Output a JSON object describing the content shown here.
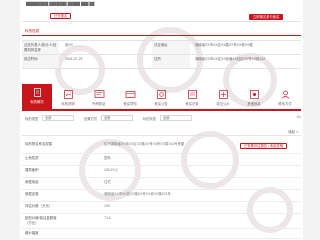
{
  "top": {
    "line1": "█████████ ███████ █████ ███ ██",
    "button_outline": "已在报名",
    "button_fill": "立即报名参与竞买"
  },
  "section_title": "标的信息",
  "info": [
    {
      "label": "法定代表人/执行人/处置机构名称",
      "value": "张XX",
      "label2": "法定地址",
      "value2": "湖南省XX市XX区XX路XX号XX栋XX楼"
    },
    {
      "label": "成交时间",
      "value": "2021-07-23",
      "label2": "住所",
      "value2": "湖南省XX市XX区XX街道XX社区XX号XX组102"
    }
  ],
  "tabs": [
    {
      "label": "标的概况",
      "icon": "document-icon"
    },
    {
      "label": "标的说明",
      "icon": "chart-icon"
    },
    {
      "label": "所有权证",
      "icon": "certificate-icon"
    },
    {
      "label": "竞买须知",
      "icon": "notice-icon"
    },
    {
      "label": "竞买公告",
      "icon": "announcement-icon"
    },
    {
      "label": "竞买记录",
      "icon": "record-icon"
    },
    {
      "label": "成交公示",
      "icon": "publicity-icon"
    },
    {
      "label": "其他信息",
      "icon": "info-icon"
    },
    {
      "label": "联系方式",
      "icon": "contact-icon"
    }
  ],
  "filters": {
    "label1": "标的类型",
    "value1": "全部",
    "label2": "处置方式",
    "value2": "全部",
    "label3": "标的状态",
    "value3": "全部",
    "page": "1/1"
  },
  "close_label": "收起 ∧",
  "detail": {
    "rows": [
      {
        "label": "标的物名称及权属",
        "value": "位于湖南省XX市XX区XX路XX号XX栋XX楼102号房屋",
        "extra": "已查看评估报告 / 收起说明"
      },
      {
        "label": "土地性质",
        "value": "国有"
      },
      {
        "label": "建筑面积",
        "value": "105.57㎡"
      },
      {
        "label": "房屋用途",
        "value": "住宅"
      },
      {
        "label": "房屋坐落",
        "value": "湖南省XX市XX区XX路XX号XX栋XX楼102号"
      },
      {
        "label": "评估价格（万元）",
        "value": "105"
      },
      {
        "label": "起拍价格/保证金额度（万元）",
        "value": "73.6"
      },
      {
        "label": "增价幅度",
        "value": ""
      }
    ]
  },
  "colors": {
    "brand": "#c8161d",
    "header_bg": "#f5f5f5"
  }
}
